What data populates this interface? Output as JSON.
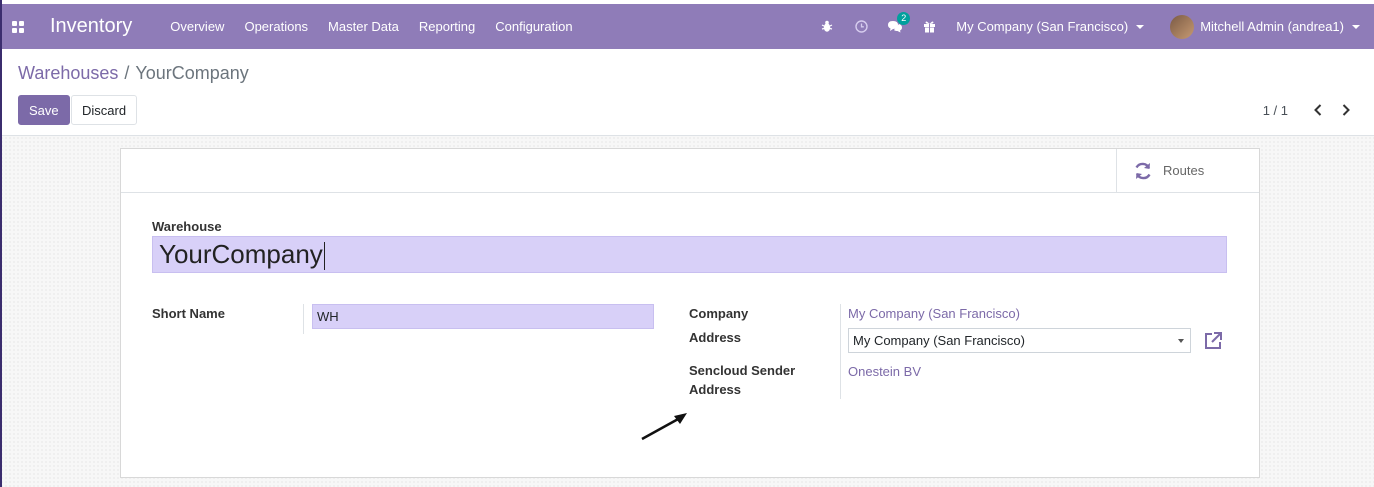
{
  "nav": {
    "app_title": "Inventory",
    "menu": [
      "Overview",
      "Operations",
      "Master Data",
      "Reporting",
      "Configuration"
    ],
    "messages_badge": "2",
    "company": "My Company (San Francisco)",
    "user": "Mitchell Admin (andrea1)"
  },
  "breadcrumb": {
    "parent": "Warehouses",
    "separator": "/",
    "current": "YourCompany"
  },
  "actions": {
    "save": "Save",
    "discard": "Discard"
  },
  "pager": {
    "value": "1 / 1"
  },
  "button_box": {
    "routes": "Routes"
  },
  "form": {
    "warehouse_label": "Warehouse",
    "warehouse_value": "YourCompany",
    "short_name_label": "Short Name",
    "short_name_value": "WH",
    "company_label": "Company",
    "company_value": "My Company (San Francisco)",
    "address_label": "Address",
    "address_value": "My Company (San Francisco)",
    "sencloud_label_1": "Sencloud Sender",
    "sencloud_label_2": "Address",
    "sencloud_value": "Onestein BV"
  },
  "colors": {
    "navbar": "#8f7cb8",
    "accent": "#7c6aa8",
    "input_bg": "#d8d0f8"
  }
}
